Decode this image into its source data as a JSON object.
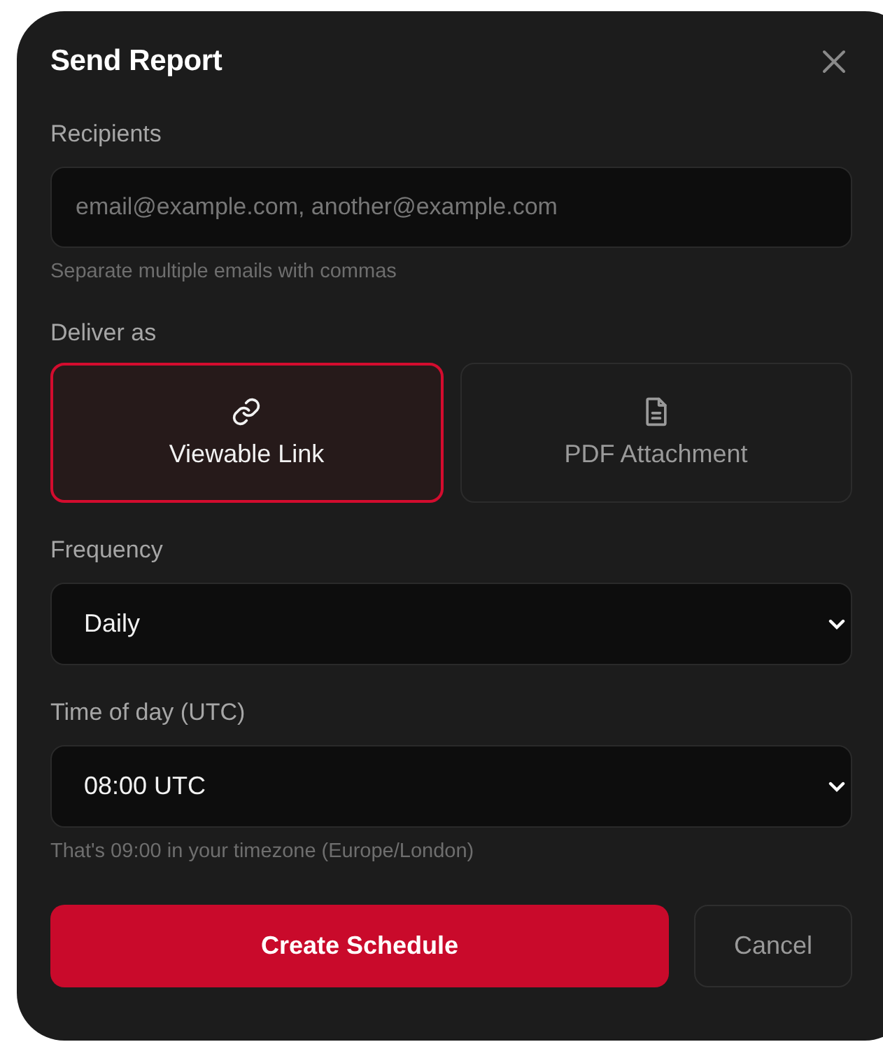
{
  "dialog": {
    "title": "Send Report"
  },
  "recipients": {
    "label": "Recipients",
    "placeholder": "email@example.com, another@example.com",
    "hint": "Separate multiple emails with commas"
  },
  "deliver_as": {
    "label": "Deliver as",
    "options": [
      {
        "kind": "link",
        "label": "Viewable Link",
        "selected": true
      },
      {
        "kind": "pdf",
        "label": "PDF Attachment",
        "selected": false
      }
    ]
  },
  "frequency": {
    "label": "Frequency",
    "value": "Daily"
  },
  "time_of_day": {
    "label": "Time of day (UTC)",
    "value": "08:00 UTC",
    "hint": "That's 09:00 in your timezone (Europe/London)"
  },
  "buttons": [
    {
      "kind": "primary",
      "label": "Create Schedule"
    },
    {
      "kind": "secondary",
      "label": "Cancel"
    }
  ]
}
